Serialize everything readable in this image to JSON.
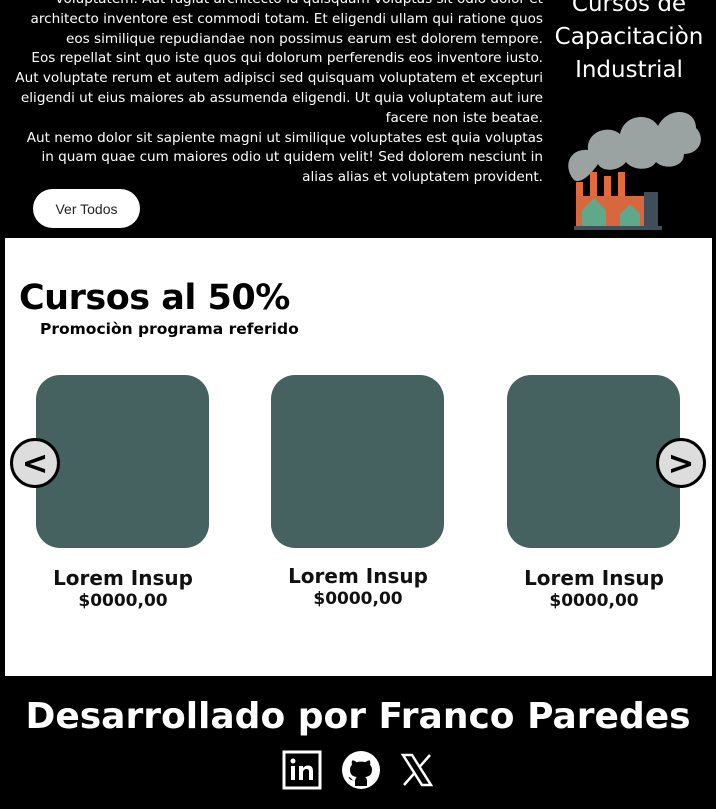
{
  "hero": {
    "paragraphs": [
      "voluptatem. Aut fugiat architecto id quisquam voluptas sit odio dolor et architecto inventore est commodi totam. Et eligendi ullam qui ratione quos eos similique repudiandae non possimus earum est dolorem tempore.",
      "Eos repellat sint quo iste quos qui dolorum perferendis eos inventore iusto. Aut voluptate rerum et autem adipisci sed quisquam voluptatem et excepturi eligendi ut eius maiores ab assumenda eligendi. Ut quia voluptatem aut iure facere non iste beatae.",
      "Aut nemo dolor sit sapiente magni ut similique voluptates est quia voluptas in quam quae cum maiores odio ut quidem velit! Sed dolorem nesciunt in alias alias et voluptatem provident."
    ],
    "button_label": "Ver Todos",
    "brand_title": "Cursos de Capacitaciòn Industrial"
  },
  "promo": {
    "title": "Cursos al 50%",
    "subtitle": "Promociòn programa referido",
    "prev_label": "<",
    "next_label": ">",
    "cards": [
      {
        "name": "Lorem Insup",
        "price": "$0000,00"
      },
      {
        "name": "Lorem Insup",
        "price": "$0000,00"
      },
      {
        "name": "Lorem Insup",
        "price": "$0000,00"
      }
    ]
  },
  "footer": {
    "title": "Desarrollado por Franco Paredes",
    "social": [
      "linkedin-icon",
      "github-icon",
      "x-icon"
    ]
  },
  "colors": {
    "card": "#466260",
    "background": "#000000",
    "accent_line": "#4a7fd4"
  }
}
